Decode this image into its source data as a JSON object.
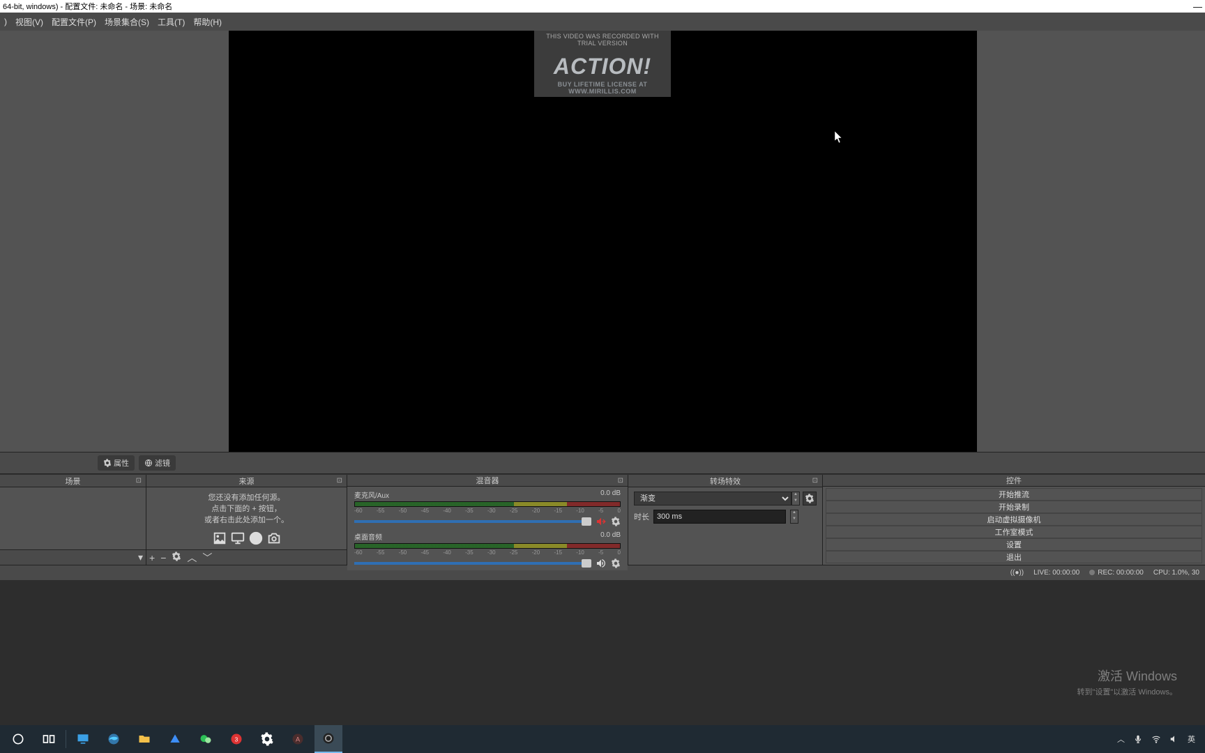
{
  "window": {
    "title": "64-bit, windows) - 配置文件: 未命名 - 场景: 未命名"
  },
  "menu": {
    "view": "视图(V)",
    "profile": "配置文件(P)",
    "scene_coll": "场景集合(S)",
    "tools": "工具(T)",
    "help": "帮助(H)"
  },
  "trial": {
    "top": "THIS VIDEO WAS RECORDED WITH TRIAL VERSION",
    "logo": "ACTION!",
    "bottom": "BUY LIFETIME LICENSE AT WWW.MIRILLIS.COM"
  },
  "toolbar": {
    "properties": "属性",
    "filters": "滤镜"
  },
  "docks": {
    "scenes": "场景",
    "sources": "来源",
    "mixer": "混音器",
    "transitions": "转场特效",
    "controls": "控件"
  },
  "sources_empty": {
    "l1": "您还没有添加任何源。",
    "l2": "点击下面的 + 按钮，",
    "l3": "或者右击此处添加一个。"
  },
  "mixer": {
    "ch1": {
      "name": "麦克风/Aux",
      "level": "0.0 dB"
    },
    "ch2": {
      "name": "桌面音频",
      "level": "0.0 dB"
    },
    "ticks": [
      "-60",
      "-55",
      "-50",
      "-45",
      "-40",
      "-35",
      "-30",
      "-25",
      "-20",
      "-15",
      "-10",
      "-5",
      "0"
    ]
  },
  "transitions": {
    "selected": "渐变",
    "duration_label": "时长",
    "duration_value": "300 ms"
  },
  "controls": {
    "b1": "开始推流",
    "b2": "开始录制",
    "b3": "启动虚拟摄像机",
    "b4": "工作室模式",
    "b5": "设置",
    "b6": "退出"
  },
  "watermark": {
    "l1": "激活 Windows",
    "l2": "转到\"设置\"以激活 Windows。"
  },
  "status": {
    "live": "LIVE: 00:00:00",
    "rec": "REC: 00:00:00",
    "cpu": "CPU: 1.0%, 30"
  },
  "tray": {
    "ime": "英"
  }
}
